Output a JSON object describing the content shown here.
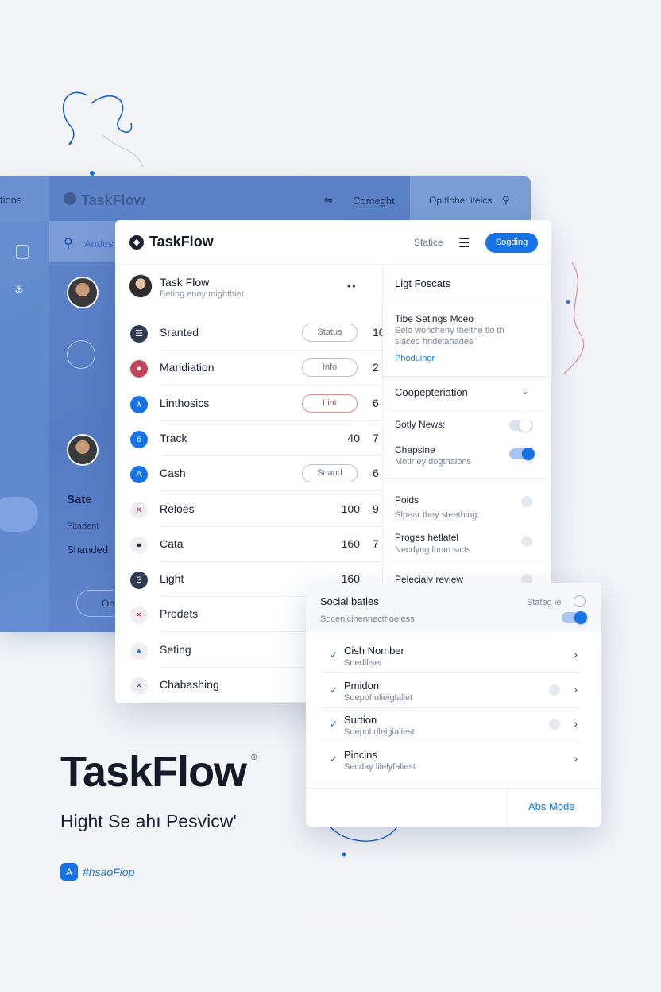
{
  "back_window": {
    "left_tab": "tions",
    "logo": "TaskFlow",
    "nav_text": "Comeght",
    "right_text": "Op tlohe: iteics",
    "search_text": "Andes",
    "sidebar_card_title": "Sate",
    "sidebar_card_sub": "Pltadent",
    "sidebar_card_label": "Shanded",
    "sidebar_card_btn": "Op"
  },
  "main": {
    "title": "TaskFlow",
    "header_status": "Statice",
    "header_button": "Sogding",
    "top_user": {
      "name": "Task Flow",
      "sub": "Beting enoy mighthiet"
    },
    "rows": [
      {
        "label": "Sranted",
        "pill": "Status",
        "num2": "10",
        "icon_bg": "#2f3b52",
        "icon": "☰"
      },
      {
        "label": "Maridiation",
        "pill": "Info",
        "num2": "2",
        "icon_bg": "#c0485a",
        "icon": "●"
      },
      {
        "label": "Linthosics",
        "pill": "Lint",
        "pill_red": true,
        "num2": "6",
        "icon_bg": "#1673e6",
        "icon": "λ"
      },
      {
        "label": "Track",
        "num": "40",
        "num2": "7",
        "icon_bg": "#1673e6",
        "icon": "6"
      },
      {
        "label": "Cash",
        "pill": "Snand",
        "num2": "6",
        "icon_bg": "#1673e6",
        "icon": "A"
      },
      {
        "label": "Reloes",
        "num": "100",
        "num2": "9",
        "icon_bg": "#f1eef3",
        "icon": "✕",
        "icon_color": "#b0305a"
      },
      {
        "label": "Cata",
        "num": "160",
        "num2": "7",
        "icon_bg": "#f1eef3",
        "icon": "●",
        "icon_color": "#2d2d2d"
      },
      {
        "label": "Light",
        "num": "160",
        "num2": "",
        "icon_bg": "#2f3b52",
        "icon": "S"
      },
      {
        "label": "Prodets",
        "icon_bg": "#f1eef3",
        "icon": "✕",
        "icon_color": "#c0303a"
      },
      {
        "label": "Seting",
        "icon_bg": "#f1eef3",
        "icon": "▲",
        "icon_color": "#1673e6"
      },
      {
        "label": "Chabashing",
        "icon_bg": "#f1eef3",
        "icon": "✕",
        "icon_color": "#5a6275"
      }
    ]
  },
  "settings": {
    "section_title": "Ligt Foscats",
    "card_title": "Tibe Setings Mceo",
    "card_sub_1": "Selo woncheny thelthe tlo th",
    "card_sub_2": "slaced hndetanades",
    "card_link": "Phoduingr",
    "row_coop": "Coopepteriation",
    "row_news": "Sotly News:",
    "row_chep": "Chepsine",
    "row_chep_sub": "Motir ey dogtnaions",
    "row_poids": "Poids",
    "row_poids_sub": "Slpear they steething:",
    "row_proges": "Proges hetlatel",
    "row_proges_sub": "Necdyng lnom sicts",
    "row_pelec": "Pelecialy review"
  },
  "popup": {
    "title": "Social batles",
    "subtitle": "Socenicinennecthoeless",
    "status": "Stateg ie",
    "items": [
      {
        "title": "Cish Nomber",
        "sub": "Snediliser",
        "has_dot": false
      },
      {
        "title": "Pmidon",
        "sub": "Soepof ulieiglaliet",
        "has_dot": true
      },
      {
        "title": "Surtion",
        "sub": "Soepol dleigialiest",
        "has_dot": true
      },
      {
        "title": "Pincins",
        "sub": "Secday lilelyfaliest",
        "has_dot": false
      }
    ],
    "more_button": "Abs Mode"
  },
  "brand": {
    "title": "TaskFlow",
    "reg": "®",
    "subtitle": "Hight Se ahı Pesvicw'",
    "tag": "#hsaoFlop"
  },
  "colors": {
    "accent": "#1673e6",
    "back_window": "#5f86c9",
    "text_dark": "#141a28"
  }
}
